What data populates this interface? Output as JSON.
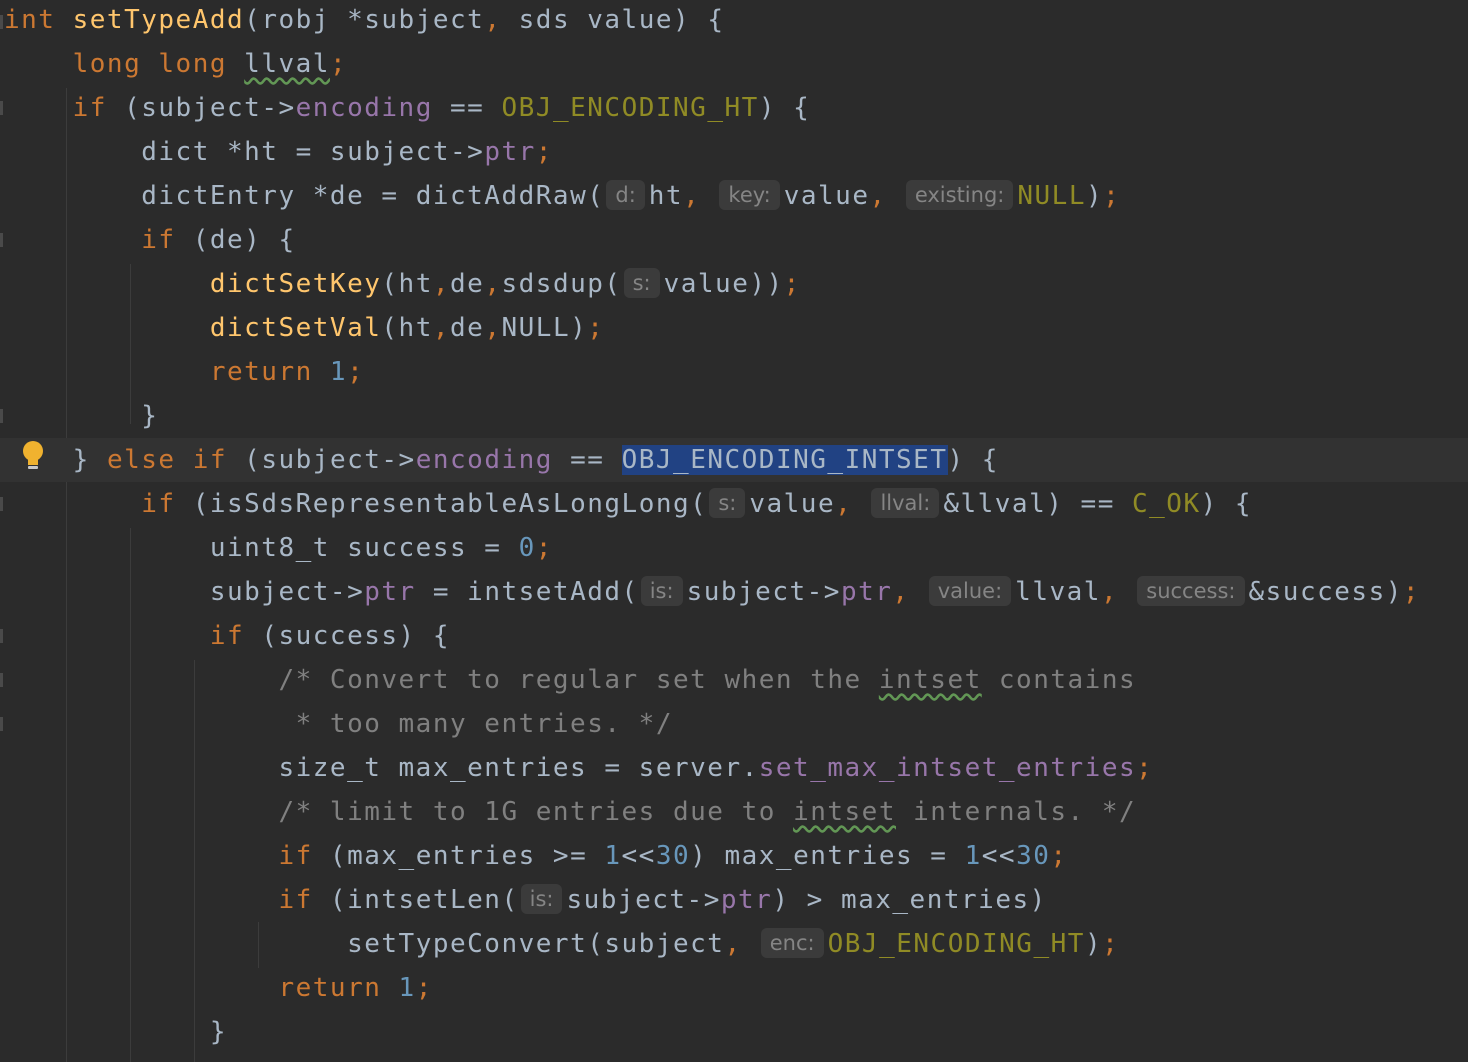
{
  "editor": {
    "lines": [
      {
        "tokens": [
          [
            "kw",
            "int "
          ],
          [
            "fn",
            "setTypeAdd"
          ],
          [
            "txt",
            "(robj *subject"
          ],
          [
            "punc",
            ","
          ],
          [
            "txt",
            " sds value) {"
          ]
        ]
      },
      {
        "tokens": [
          [
            "ind",
            "    "
          ],
          [
            "kw",
            "long long "
          ],
          [
            "squig",
            "llval"
          ],
          [
            "punc",
            ";"
          ]
        ]
      },
      {
        "tokens": [
          [
            "ind",
            "    "
          ],
          [
            "kw",
            "if "
          ],
          [
            "txt",
            "(subject->"
          ],
          [
            "fld",
            "encoding"
          ],
          [
            "txt",
            " == "
          ],
          [
            "mac",
            "OBJ_ENCODING_HT"
          ],
          [
            "txt",
            ") {"
          ]
        ]
      },
      {
        "tokens": [
          [
            "ind",
            "        "
          ],
          [
            "txt",
            "dict *ht = subject->"
          ],
          [
            "fld",
            "ptr"
          ],
          [
            "punc",
            ";"
          ]
        ]
      },
      {
        "tokens": [
          [
            "ind",
            "        "
          ],
          [
            "txt",
            "dictEntry *de = dictAddRaw("
          ],
          [
            "hint",
            "d:"
          ],
          [
            "txt",
            "ht"
          ],
          [
            "punc",
            ", "
          ],
          [
            "hint",
            "key:"
          ],
          [
            "txt",
            "value"
          ],
          [
            "punc",
            ", "
          ],
          [
            "hint",
            "existing:"
          ],
          [
            "mac",
            "NULL"
          ],
          [
            "txt",
            ")"
          ],
          [
            "punc",
            ";"
          ]
        ]
      },
      {
        "tokens": [
          [
            "ind",
            "        "
          ],
          [
            "kw",
            "if "
          ],
          [
            "txt",
            "(de) {"
          ]
        ]
      },
      {
        "tokens": [
          [
            "ind",
            "            "
          ],
          [
            "fn",
            "dictSetKey"
          ],
          [
            "txt",
            "(ht"
          ],
          [
            "punc",
            ","
          ],
          [
            "txt",
            "de"
          ],
          [
            "punc",
            ","
          ],
          [
            "txt",
            "sdsdup("
          ],
          [
            "hint",
            "s:"
          ],
          [
            "txt",
            "value))"
          ],
          [
            "punc",
            ";"
          ]
        ]
      },
      {
        "tokens": [
          [
            "ind",
            "            "
          ],
          [
            "fn",
            "dictSetVal"
          ],
          [
            "txt",
            "(ht"
          ],
          [
            "punc",
            ","
          ],
          [
            "txt",
            "de"
          ],
          [
            "punc",
            ","
          ],
          [
            "txt",
            "NULL)"
          ],
          [
            "punc",
            ";"
          ]
        ]
      },
      {
        "tokens": [
          [
            "ind",
            "            "
          ],
          [
            "kw",
            "return "
          ],
          [
            "num",
            "1"
          ],
          [
            "punc",
            ";"
          ]
        ]
      },
      {
        "tokens": [
          [
            "ind",
            "        "
          ],
          [
            "txt",
            "}"
          ]
        ]
      },
      {
        "current": true,
        "tokens": [
          [
            "ind",
            "    "
          ],
          [
            "txt",
            "} "
          ],
          [
            "kw",
            "else if "
          ],
          [
            "txt",
            "(subject->"
          ],
          [
            "fld",
            "encoding"
          ],
          [
            "txt",
            " == "
          ],
          [
            "sel",
            "OBJ_ENCODING_INTSET"
          ],
          [
            "txt",
            ") {"
          ]
        ]
      },
      {
        "tokens": [
          [
            "ind",
            "        "
          ],
          [
            "kw",
            "if "
          ],
          [
            "txt",
            "(isSdsRepresentableAsLongLong("
          ],
          [
            "hint",
            "s:"
          ],
          [
            "txt",
            "value"
          ],
          [
            "punc",
            ", "
          ],
          [
            "hint",
            "llval:"
          ],
          [
            "txt",
            "&llval) == "
          ],
          [
            "mac",
            "C_OK"
          ],
          [
            "txt",
            ") {"
          ]
        ]
      },
      {
        "tokens": [
          [
            "ind",
            "            "
          ],
          [
            "txt",
            "uint8_t success = "
          ],
          [
            "num",
            "0"
          ],
          [
            "punc",
            ";"
          ]
        ]
      },
      {
        "tokens": [
          [
            "ind",
            "            "
          ],
          [
            "txt",
            "subject->"
          ],
          [
            "fld",
            "ptr"
          ],
          [
            "txt",
            " = intsetAdd("
          ],
          [
            "hint",
            "is:"
          ],
          [
            "txt",
            "subject->"
          ],
          [
            "fld",
            "ptr"
          ],
          [
            "punc",
            ", "
          ],
          [
            "hint",
            "value:"
          ],
          [
            "txt",
            "llval"
          ],
          [
            "punc",
            ", "
          ],
          [
            "hint",
            "success:"
          ],
          [
            "txt",
            "&success)"
          ],
          [
            "punc",
            ";"
          ]
        ]
      },
      {
        "tokens": [
          [
            "ind",
            "            "
          ],
          [
            "kw",
            "if "
          ],
          [
            "txt",
            "(success) {"
          ]
        ]
      },
      {
        "tokens": [
          [
            "ind",
            "                "
          ],
          [
            "com",
            "/* Convert to regular set when the "
          ],
          [
            "squigc",
            "intset"
          ],
          [
            "com",
            " contains"
          ]
        ]
      },
      {
        "tokens": [
          [
            "ind",
            "                "
          ],
          [
            "com",
            " * too many entries. */"
          ]
        ]
      },
      {
        "tokens": [
          [
            "ind",
            "                "
          ],
          [
            "txt",
            "size_t max_entries = server."
          ],
          [
            "fld",
            "set_max_intset_entries"
          ],
          [
            "punc",
            ";"
          ]
        ]
      },
      {
        "tokens": [
          [
            "ind",
            "                "
          ],
          [
            "com",
            "/* limit to 1G entries due to "
          ],
          [
            "squigc",
            "intset"
          ],
          [
            "com",
            " internals. */"
          ]
        ]
      },
      {
        "tokens": [
          [
            "ind",
            "                "
          ],
          [
            "kw",
            "if "
          ],
          [
            "txt",
            "(max_entries >= "
          ],
          [
            "num",
            "1"
          ],
          [
            "txt",
            "<<"
          ],
          [
            "num",
            "30"
          ],
          [
            "txt",
            ") max_entries = "
          ],
          [
            "num",
            "1"
          ],
          [
            "txt",
            "<<"
          ],
          [
            "num",
            "30"
          ],
          [
            "punc",
            ";"
          ]
        ]
      },
      {
        "tokens": [
          [
            "ind",
            "                "
          ],
          [
            "kw",
            "if "
          ],
          [
            "txt",
            "(intsetLen("
          ],
          [
            "hint",
            "is:"
          ],
          [
            "txt",
            "subject->"
          ],
          [
            "fld",
            "ptr"
          ],
          [
            "txt",
            ") > max_entries)"
          ]
        ]
      },
      {
        "tokens": [
          [
            "ind",
            "                    "
          ],
          [
            "txt",
            "setTypeConvert(subject"
          ],
          [
            "punc",
            ", "
          ],
          [
            "hint",
            "enc:"
          ],
          [
            "mac",
            "OBJ_ENCODING_HT"
          ],
          [
            "txt",
            ")"
          ],
          [
            "punc",
            ";"
          ]
        ]
      },
      {
        "tokens": [
          [
            "ind",
            "                "
          ],
          [
            "kw",
            "return "
          ],
          [
            "num",
            "1"
          ],
          [
            "punc",
            ";"
          ]
        ]
      },
      {
        "tokens": [
          [
            "ind",
            "            "
          ],
          [
            "txt",
            "}"
          ]
        ]
      }
    ]
  }
}
